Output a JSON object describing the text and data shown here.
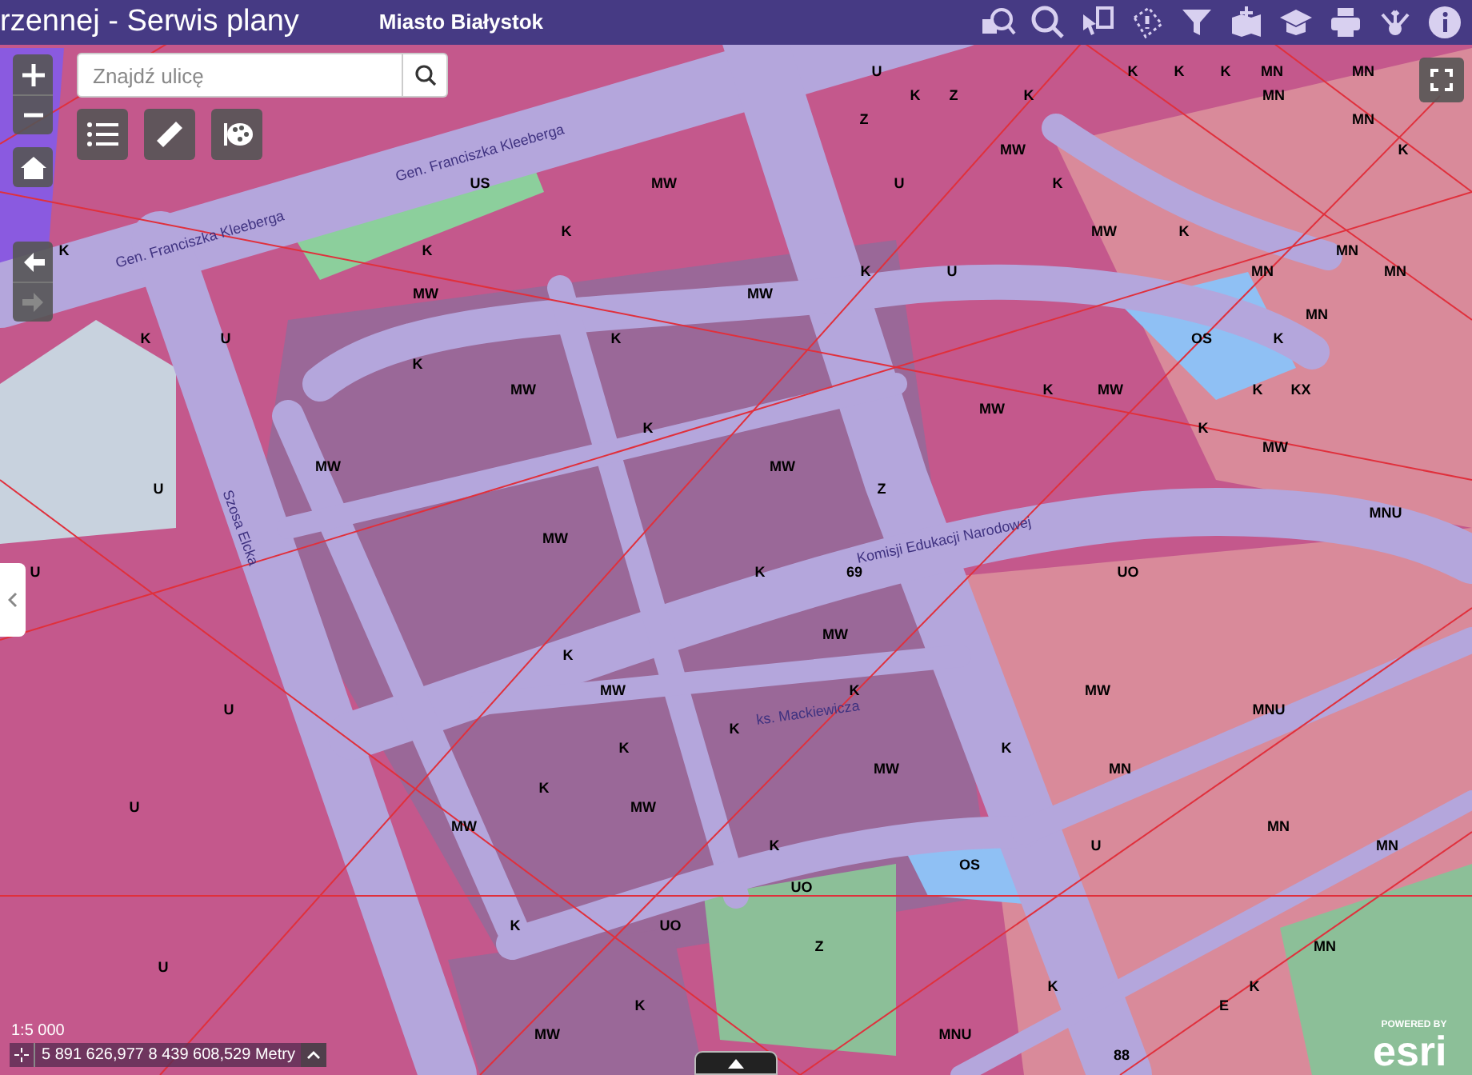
{
  "header": {
    "title": "rzennej - Serwis plany",
    "subtitle": "Miasto Białystok"
  },
  "search": {
    "placeholder": "Znajdź ulicę"
  },
  "navigation": [
    {
      "kind": "back",
      "disabled": false
    },
    {
      "kind": "forward",
      "disabled": true
    }
  ],
  "map_labels": [
    "U",
    "K",
    "K",
    "K",
    "MN",
    "MN",
    "K",
    "Z",
    "K",
    "MN",
    "Z",
    "MN",
    "MW",
    "K",
    "US",
    "MW",
    "U",
    "K",
    "K",
    "MW",
    "K",
    "K",
    "K",
    "MN",
    "K",
    "U",
    "MN",
    "MN",
    "MW",
    "MW",
    "MN",
    "K",
    "U",
    "K",
    "OS",
    "K",
    "K",
    "MW",
    "K",
    "MW",
    "K",
    "KX",
    "MW",
    "K",
    "K",
    "MW",
    "MW",
    "MW",
    "U",
    "Z",
    "MNU",
    "MW",
    "U",
    "K",
    "69",
    "UO",
    "MW",
    "K",
    "MW",
    "K",
    "MW",
    "U",
    "MNU",
    "K",
    "K",
    "K",
    "MW",
    "MN",
    "K",
    "U",
    "MW",
    "MW",
    "MN",
    "K",
    "U",
    "MN",
    "OS",
    "UO",
    "K",
    "UO",
    "Z",
    "MN",
    "U",
    "K",
    "K",
    "K",
    "E",
    "MW",
    "MNU",
    "88"
  ],
  "street_labels": [
    "Gen. Franciszka Kleeberga",
    "Gen. Franciszka Kleeberga",
    "Szosa Elcka",
    "Komisji Edukacji Narodowej",
    "ks. Mackiewicza"
  ],
  "scale": "1:5 000",
  "coordinates": "5 891 626,977 8 439 608,529 Metry",
  "attribution": {
    "powered_by": "POWERED BY",
    "logo": "esri"
  }
}
